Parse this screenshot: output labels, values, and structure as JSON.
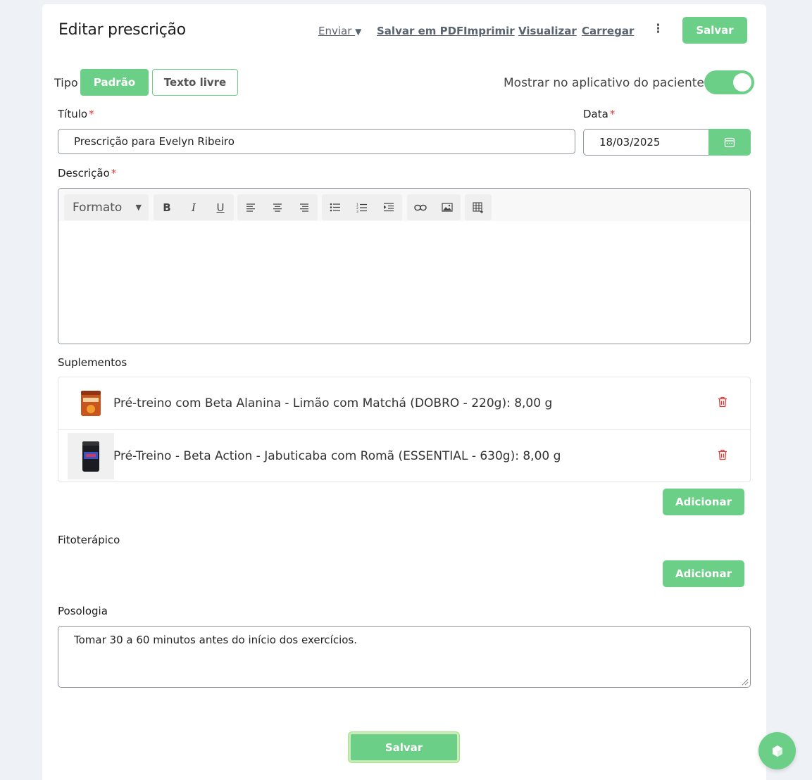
{
  "header": {
    "title": "Editar prescrição",
    "send_label": "Enviar",
    "pdf_label": "Salvar em PDF",
    "print_label": "Imprimir",
    "view_label": "Visualizar",
    "load_label": "Carregar",
    "more_icon": "kebab-icon",
    "save_label": "Salvar"
  },
  "type": {
    "label": "Tipo",
    "options": [
      "Padrão",
      "Texto livre"
    ],
    "selected": "Padrão"
  },
  "show_in_app": {
    "label": "Mostrar no aplicativo do paciente",
    "enabled": true
  },
  "title_field": {
    "label": "Título",
    "value": "Prescrição para Evelyn Ribeiro"
  },
  "date_field": {
    "label": "Data",
    "value": "18/03/2025",
    "icon": "calendar-icon"
  },
  "description": {
    "label": "Descrição",
    "format_label": "Formato",
    "tools": [
      "bold",
      "italic",
      "underline",
      "align-left",
      "align-center",
      "align-right",
      "bullet-list",
      "numbered-list",
      "indent",
      "link",
      "image",
      "table"
    ],
    "content": ""
  },
  "supplements": {
    "label": "Suplementos",
    "items": [
      {
        "text": "Pré-treino com Beta Alanina - Limão com Matchá (DOBRO - 220g): 8,00 g"
      },
      {
        "text": "Pré-Treino - Beta Action - Jabuticaba com Romã (ESSENTIAL - 630g): 8,00 g"
      }
    ],
    "add_label": "Adicionar"
  },
  "phytotherapy": {
    "label": "Fitoterápico",
    "add_label": "Adicionar"
  },
  "posology": {
    "label": "Posologia",
    "value": "Tomar 30 a 60 minutos antes do início dos exercícios."
  },
  "footer": {
    "save_label": "Salvar"
  },
  "colors": {
    "accent": "#6ccf87",
    "required": "#e53935",
    "delete": "#e53935"
  }
}
